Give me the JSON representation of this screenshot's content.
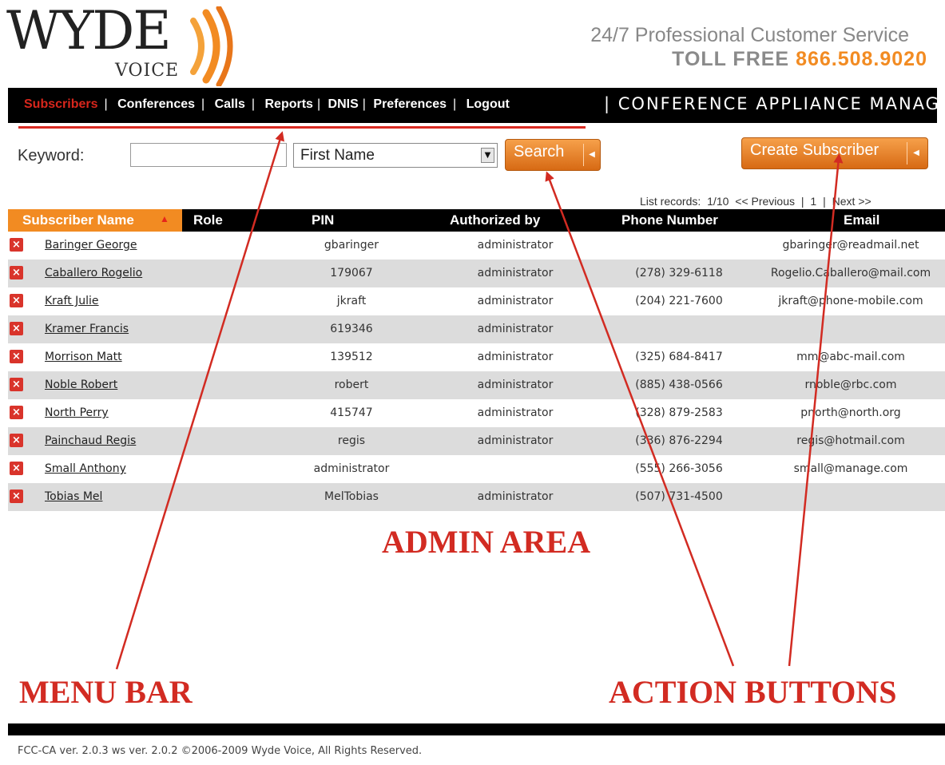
{
  "brand": {
    "logo_main": "WYDE",
    "logo_sub": "VOICE"
  },
  "tagline": {
    "line1": "24/7 Professional Customer Service",
    "toll_free_label": "TOLL  FREE",
    "phone": "866.508.9020"
  },
  "menu": {
    "items": [
      "Subscribers",
      "Conferences",
      "Calls",
      "Reports",
      "DNIS",
      "Preferences",
      "Logout"
    ],
    "active": "Subscribers",
    "app_name": "CONFERENCE APPLIANCE MANAGER"
  },
  "search": {
    "keyword_label": "Keyword:",
    "keyword_value": "",
    "field_selected": "First Name",
    "search_label": "Search",
    "create_label": "Create Subscriber"
  },
  "pager": {
    "label": "List records:",
    "range": "1/10",
    "prev": "<< Previous",
    "sep": "|",
    "page": "1",
    "next": "Next >>"
  },
  "table": {
    "columns": [
      "Subscriber Name",
      "Role",
      "PIN",
      "Authorized by",
      "Phone Number",
      "Email"
    ],
    "sort_indicator": "▲",
    "rows": [
      {
        "name": "Baringer George",
        "pin": "gbaringer",
        "auth": "administrator",
        "phone": "",
        "email": "gbaringer@readmail.net"
      },
      {
        "name": "Caballero Rogelio",
        "pin": "179067",
        "auth": "administrator",
        "phone": "(278) 329-6118",
        "email": "Rogelio.Caballero@mail.com"
      },
      {
        "name": "Kraft Julie",
        "pin": "jkraft",
        "auth": "administrator",
        "phone": "(204) 221-7600",
        "email": "jkraft@phone-mobile.com"
      },
      {
        "name": "Kramer Francis",
        "pin": "619346",
        "auth": "administrator",
        "phone": "",
        "email": ""
      },
      {
        "name": "Morrison Matt",
        "pin": "139512",
        "auth": "administrator",
        "phone": "(325) 684-8417",
        "email": "mm@abc-mail.com"
      },
      {
        "name": "Noble Robert",
        "pin": "robert",
        "auth": "administrator",
        "phone": "(885) 438-0566",
        "email": "rnoble@rbc.com"
      },
      {
        "name": "North Perry",
        "pin": "415747",
        "auth": "administrator",
        "phone": "(328) 879-2583",
        "email": "pnorth@north.org"
      },
      {
        "name": "Painchaud Regis",
        "pin": "regis",
        "auth": "administrator",
        "phone": "(336) 876-2294",
        "email": "regis@hotmail.com"
      },
      {
        "name": "Small Anthony",
        "pin": "administrator",
        "auth": "",
        "phone": "(555) 266-3056",
        "email": "small@manage.com"
      },
      {
        "name": "Tobias Mel",
        "pin": "MelTobias",
        "auth": "administrator",
        "phone": "(507) 731-4500",
        "email": ""
      }
    ]
  },
  "annotations": {
    "admin": "ADMIN AREA",
    "menu": "MENU BAR",
    "action": "ACTION BUTTONS"
  },
  "footer": {
    "text": "FCC-CA ver. 2.0.3 ws ver. 2.0.2 ©2006-2009 Wyde Voice, All Rights Reserved."
  },
  "colors": {
    "accent_orange": "#f28b22",
    "annotation_red": "#d22b22",
    "menu_active": "#d8261c",
    "bar_black": "#000000"
  }
}
